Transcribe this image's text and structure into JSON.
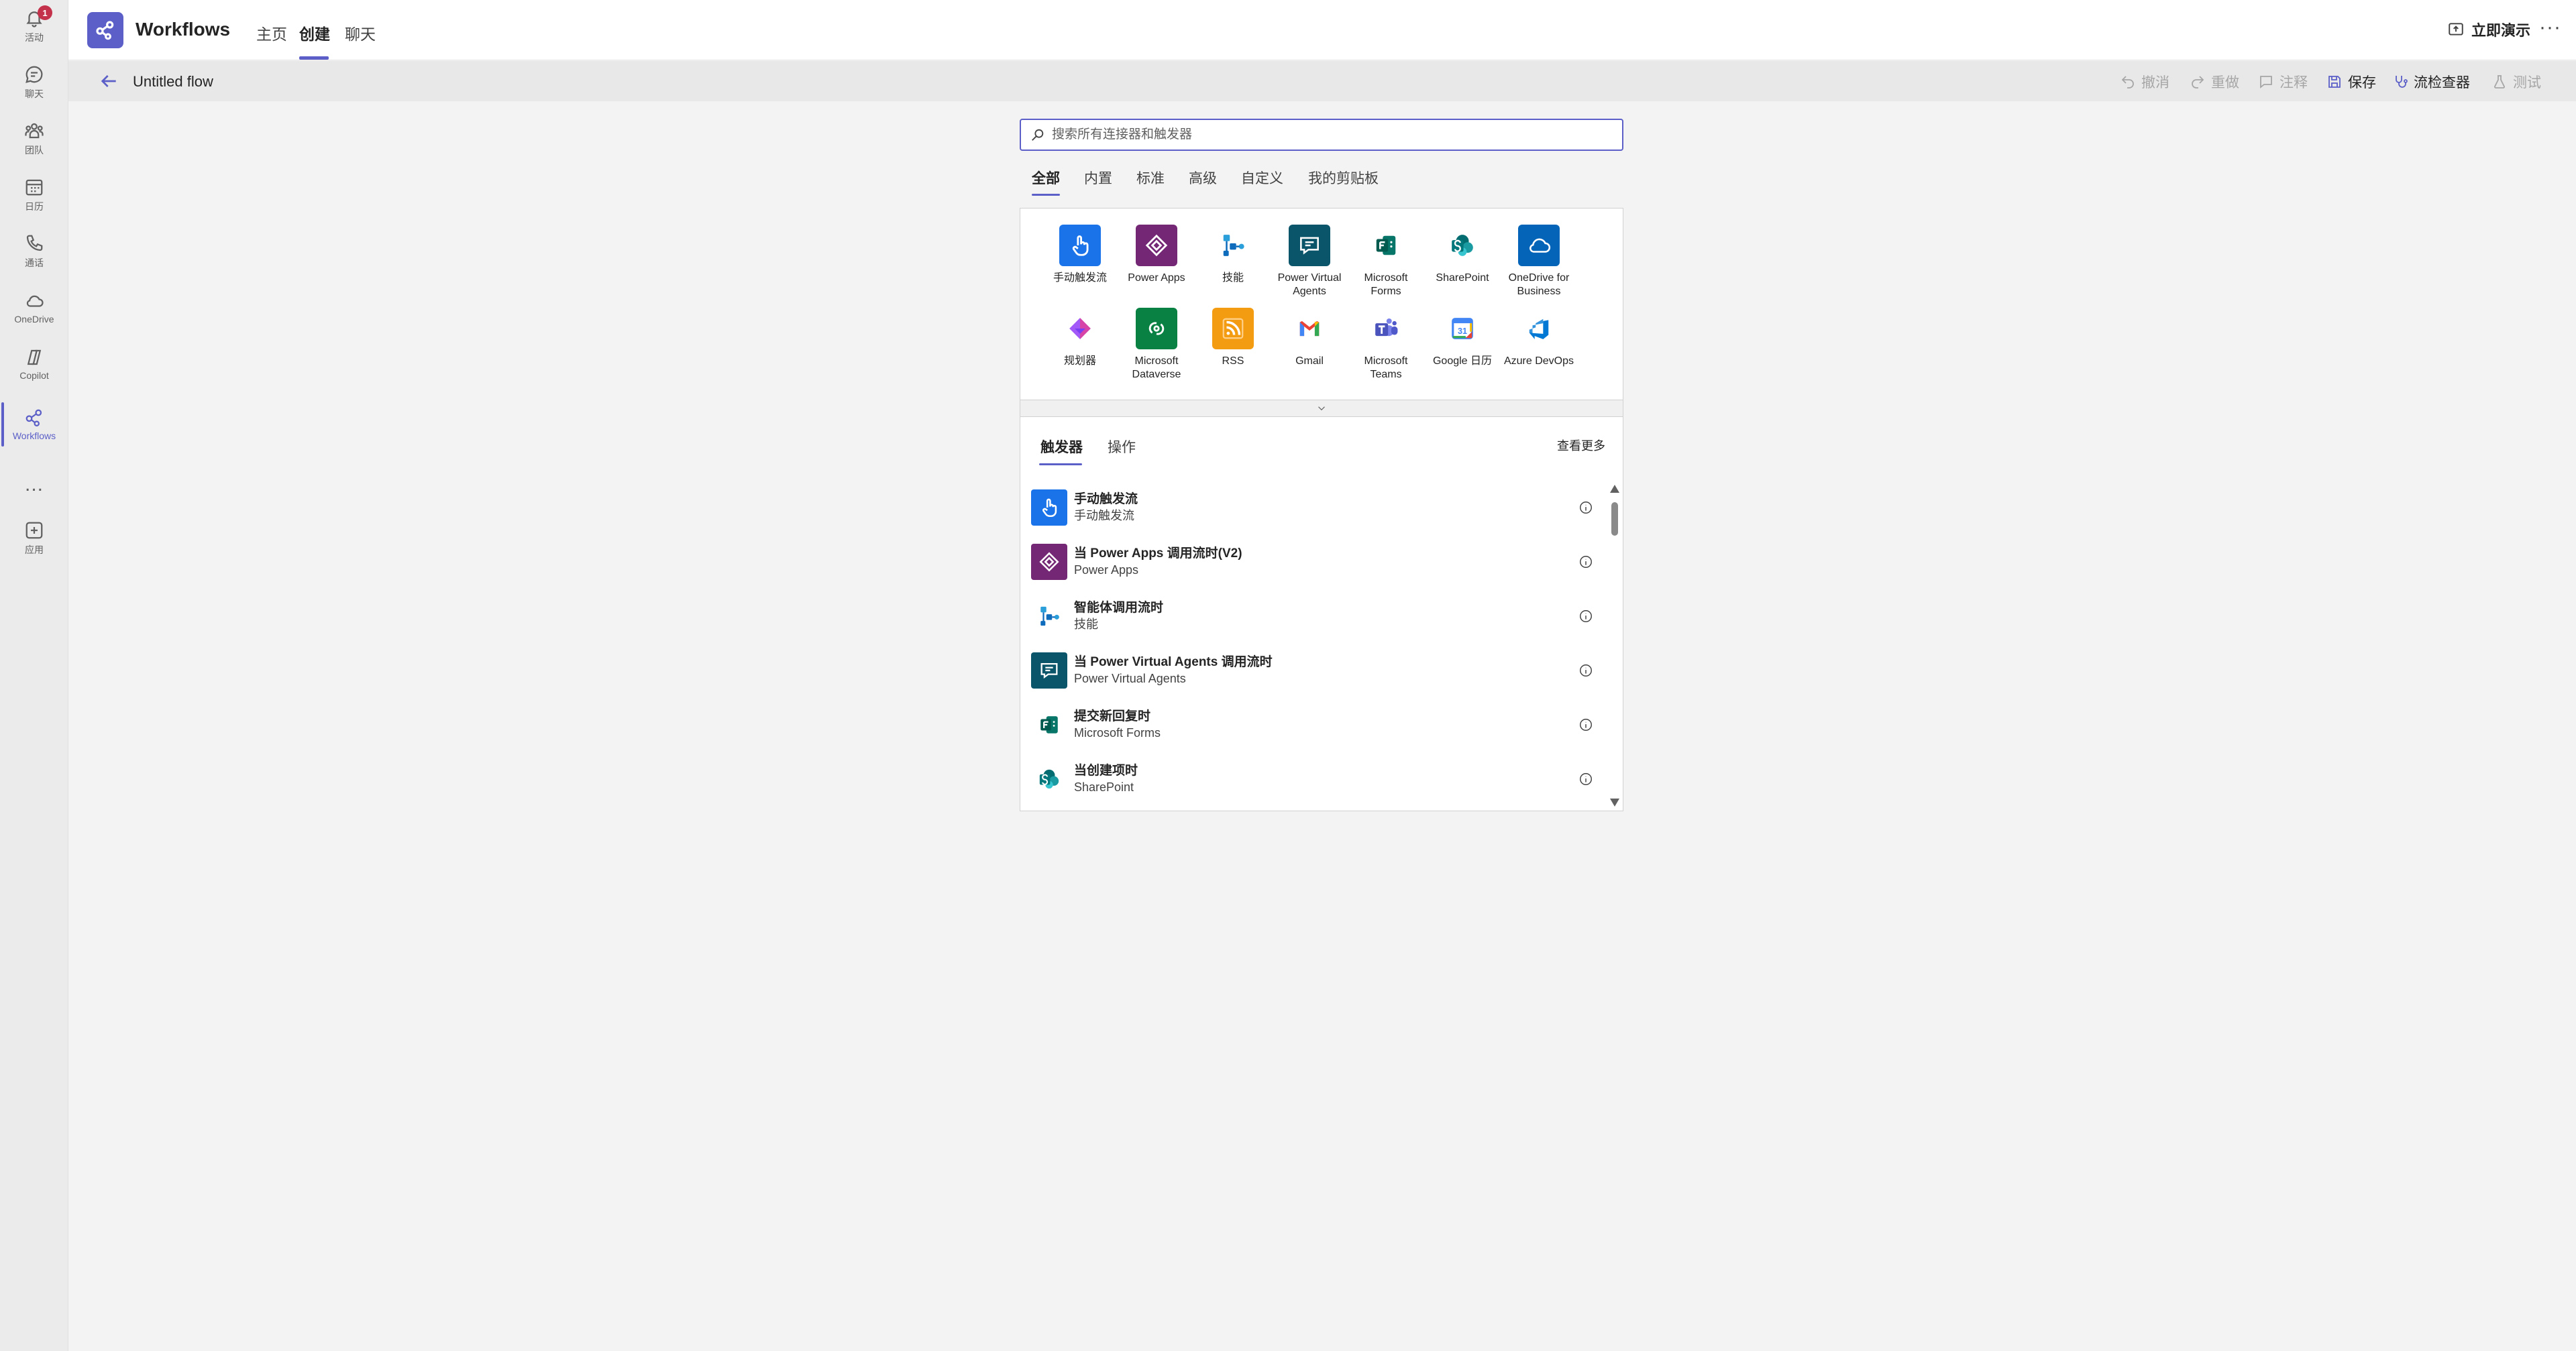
{
  "rail": {
    "items": [
      {
        "label": "活动",
        "badge": "1"
      },
      {
        "label": "聊天"
      },
      {
        "label": "团队"
      },
      {
        "label": "日历"
      },
      {
        "label": "通话"
      },
      {
        "label": "OneDrive"
      },
      {
        "label": "Copilot"
      },
      {
        "label": "Workflows"
      },
      {
        "label": "..."
      },
      {
        "label": "应用"
      }
    ]
  },
  "header": {
    "title": "Workflows",
    "tabs": [
      {
        "label": "主页"
      },
      {
        "label": "创建"
      },
      {
        "label": "聊天"
      }
    ],
    "present_label": "立即演示",
    "more": "···"
  },
  "toolbar": {
    "flow_name": "Untitled flow",
    "undo": "撤消",
    "redo": "重做",
    "comment": "注释",
    "save": "保存",
    "checker": "流检查器",
    "test": "测试"
  },
  "search": {
    "placeholder": "搜索所有连接器和触发器",
    "value": ""
  },
  "categories": [
    {
      "label": "全部"
    },
    {
      "label": "内置"
    },
    {
      "label": "标准"
    },
    {
      "label": "高级"
    },
    {
      "label": "自定义"
    },
    {
      "label": "我的剪贴板"
    }
  ],
  "connectors": [
    {
      "label": "手动触发流",
      "icon": "hand-tap-icon",
      "color": "#1a73e8"
    },
    {
      "label": "Power Apps",
      "icon": "power-apps-icon",
      "color": "#742774"
    },
    {
      "label": "技能",
      "icon": "skills-icon",
      "color": "#0f6cbd"
    },
    {
      "label": "Power Virtual Agents",
      "icon": "chat-bot-icon",
      "color": "#0b556a"
    },
    {
      "label": "Microsoft Forms",
      "icon": "forms-icon",
      "color": "#077568"
    },
    {
      "label": "SharePoint",
      "icon": "sharepoint-icon",
      "color": "#038387"
    },
    {
      "label": "OneDrive for Business",
      "icon": "onedrive-icon",
      "color": "#0364b8"
    },
    {
      "label": "规划器",
      "icon": "planner-icon",
      "color": "#7b3ff2"
    },
    {
      "label": "Microsoft Dataverse",
      "icon": "dataverse-icon",
      "color": "#088142"
    },
    {
      "label": "RSS",
      "icon": "rss-icon",
      "color": "#f39c12"
    },
    {
      "label": "Gmail",
      "icon": "gmail-icon",
      "color": "#ea4335"
    },
    {
      "label": "Microsoft Teams",
      "icon": "teams-icon",
      "color": "#5b5fc7"
    },
    {
      "label": "Google 日历",
      "icon": "google-calendar-icon",
      "color": "#4285f4",
      "day": "31"
    },
    {
      "label": "Azure DevOps",
      "icon": "azure-devops-icon",
      "color": "#0078d4"
    }
  ],
  "trigger_tabs": [
    {
      "label": "触发器"
    },
    {
      "label": "操作"
    }
  ],
  "see_more": "查看更多",
  "triggers": [
    {
      "title": "手动触发流",
      "subtitle": "手动触发流",
      "icon": "hand-tap-icon",
      "color": "#1a73e8"
    },
    {
      "title": "当 Power Apps 调用流时(V2)",
      "subtitle": "Power Apps",
      "icon": "power-apps-icon",
      "color": "#742774"
    },
    {
      "title": "智能体调用流时",
      "subtitle": "技能",
      "icon": "skills-icon",
      "color": "#0f6cbd"
    },
    {
      "title": "当 Power Virtual Agents 调用流时",
      "subtitle": "Power Virtual Agents",
      "icon": "chat-bot-icon",
      "color": "#0b556a"
    },
    {
      "title": "提交新回复时",
      "subtitle": "Microsoft Forms",
      "icon": "forms-icon",
      "color": "#077568"
    },
    {
      "title": "当创建项时",
      "subtitle": "SharePoint",
      "icon": "sharepoint-icon",
      "color": "#038387"
    }
  ]
}
